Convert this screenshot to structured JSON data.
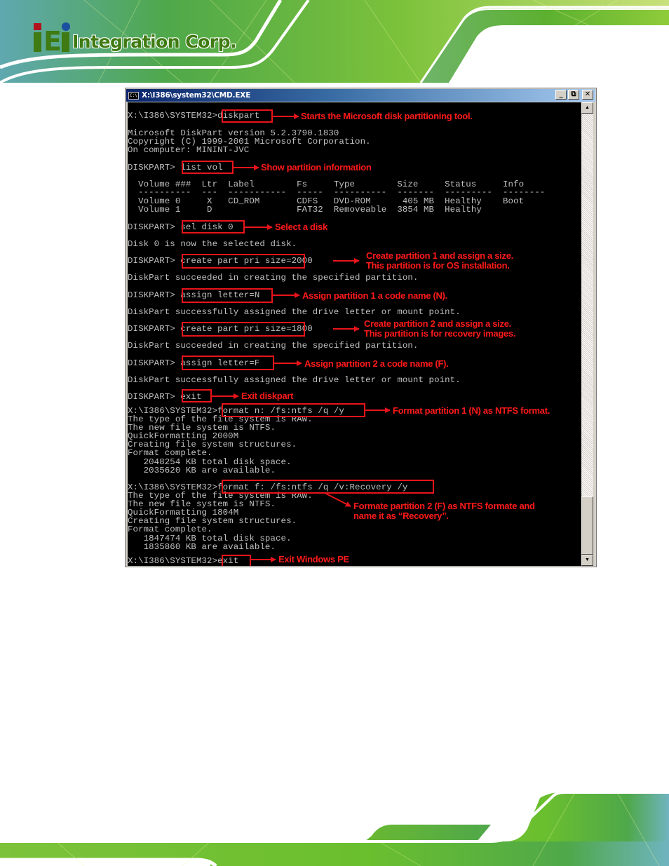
{
  "header": {
    "logo_text": "Integration Corp.",
    "logo_mark_letters": "iEi"
  },
  "window": {
    "title": "X:\\I386\\system32\\CMD.EXE",
    "icon_label": "C:\\",
    "buttons": {
      "minimize": "_",
      "restore": "⧉",
      "close": "✕"
    },
    "scroll_up": "▲",
    "scroll_down": "▼"
  },
  "console": {
    "lines": [
      "X:\\I386\\SYSTEM32>diskpart",
      "Microsoft DiskPart version 5.2.3790.1830",
      "Copyright (C) 1999-2001 Microsoft Corporation.",
      "On computer: MININT-JVC",
      "DISKPART> list vol",
      "  Volume ###  Ltr  Label        Fs     Type        Size     Status     Info",
      "  ----------  ---  -----------  -----  ----------  -------  ---------  --------",
      "  Volume 0     X   CD_ROM       CDFS   DVD-ROM      405 MB  Healthy    Boot",
      "  Volume 1     D                FAT32  Removeable  3854 MB  Healthy",
      "DISKPART> sel disk 0",
      "Disk 0 is now the selected disk.",
      "DISKPART> create part pri size=2000",
      "DiskPart succeeded in creating the specified partition.",
      "DISKPART> assign letter=N",
      "DiskPart successfully assigned the drive letter or mount point.",
      "DISKPART> create part pri size=1800",
      "DiskPart succeeded in creating the specified partition.",
      "DISKPART> assign letter=F",
      "DiskPart successfully assigned the drive letter or mount point.",
      "DISKPART> exit",
      "X:\\I386\\SYSTEM32>format n: /fs:ntfs /q /y",
      "The type of the file system is RAW.",
      "The new file system is NTFS.",
      "QuickFormatting 2000M",
      "Creating file system structures.",
      "Format complete.",
      "   2048254 KB total disk space.",
      "   2035620 KB are available.",
      "X:\\I386\\SYSTEM32>format f: /fs:ntfs /q /v:Recovery /y",
      "The type of the file system is RAW.",
      "The new file system is NTFS.",
      "QuickFormatting 1804M",
      "Creating file system structures.",
      "Format complete.",
      "   1847474 KB total disk space.",
      "   1835860 KB are available.",
      "X:\\I386\\SYSTEM32>exit"
    ],
    "volume_table": {
      "columns": [
        "Volume ###",
        "Ltr",
        "Label",
        "Fs",
        "Type",
        "Size",
        "Status",
        "Info"
      ],
      "rows": [
        [
          "Volume 0",
          "X",
          "CD_ROM",
          "CDFS",
          "DVD-ROM",
          "405 MB",
          "Healthy",
          "Boot"
        ],
        [
          "Volume 1",
          "D",
          "",
          "FAT32",
          "Removeable",
          "3854 MB",
          "Healthy",
          ""
        ]
      ]
    }
  },
  "annotations": {
    "diskpart": "Starts the Microsoft disk partitioning tool.",
    "list_vol": "Show partition information",
    "sel_disk": "Select a disk",
    "create_part1_l1": "Create partition 1 and assign a size.",
    "create_part1_l2": "This partition is for OS installation.",
    "assign_n": "Assign partition 1 a code name (N).",
    "create_part2_l1": "Create partition 2 and assign a size.",
    "create_part2_l2": "This partition is for recovery images.",
    "assign_f": "Assign partition 2 a code name (F).",
    "exit_diskpart": "Exit diskpart",
    "format_n": "Format partition 1 (N) as NTFS format.",
    "format_f_l1": "Formate partition 2 (F) as NTFS formate and",
    "format_f_l2": "name it as “Recovery”.",
    "exit_pe": "Exit Windows PE"
  },
  "colors": {
    "annotation_red": "#ff1a1a",
    "console_bg": "#000000",
    "console_text": "#c0c0c0",
    "brand_green": "#3f7a12"
  }
}
